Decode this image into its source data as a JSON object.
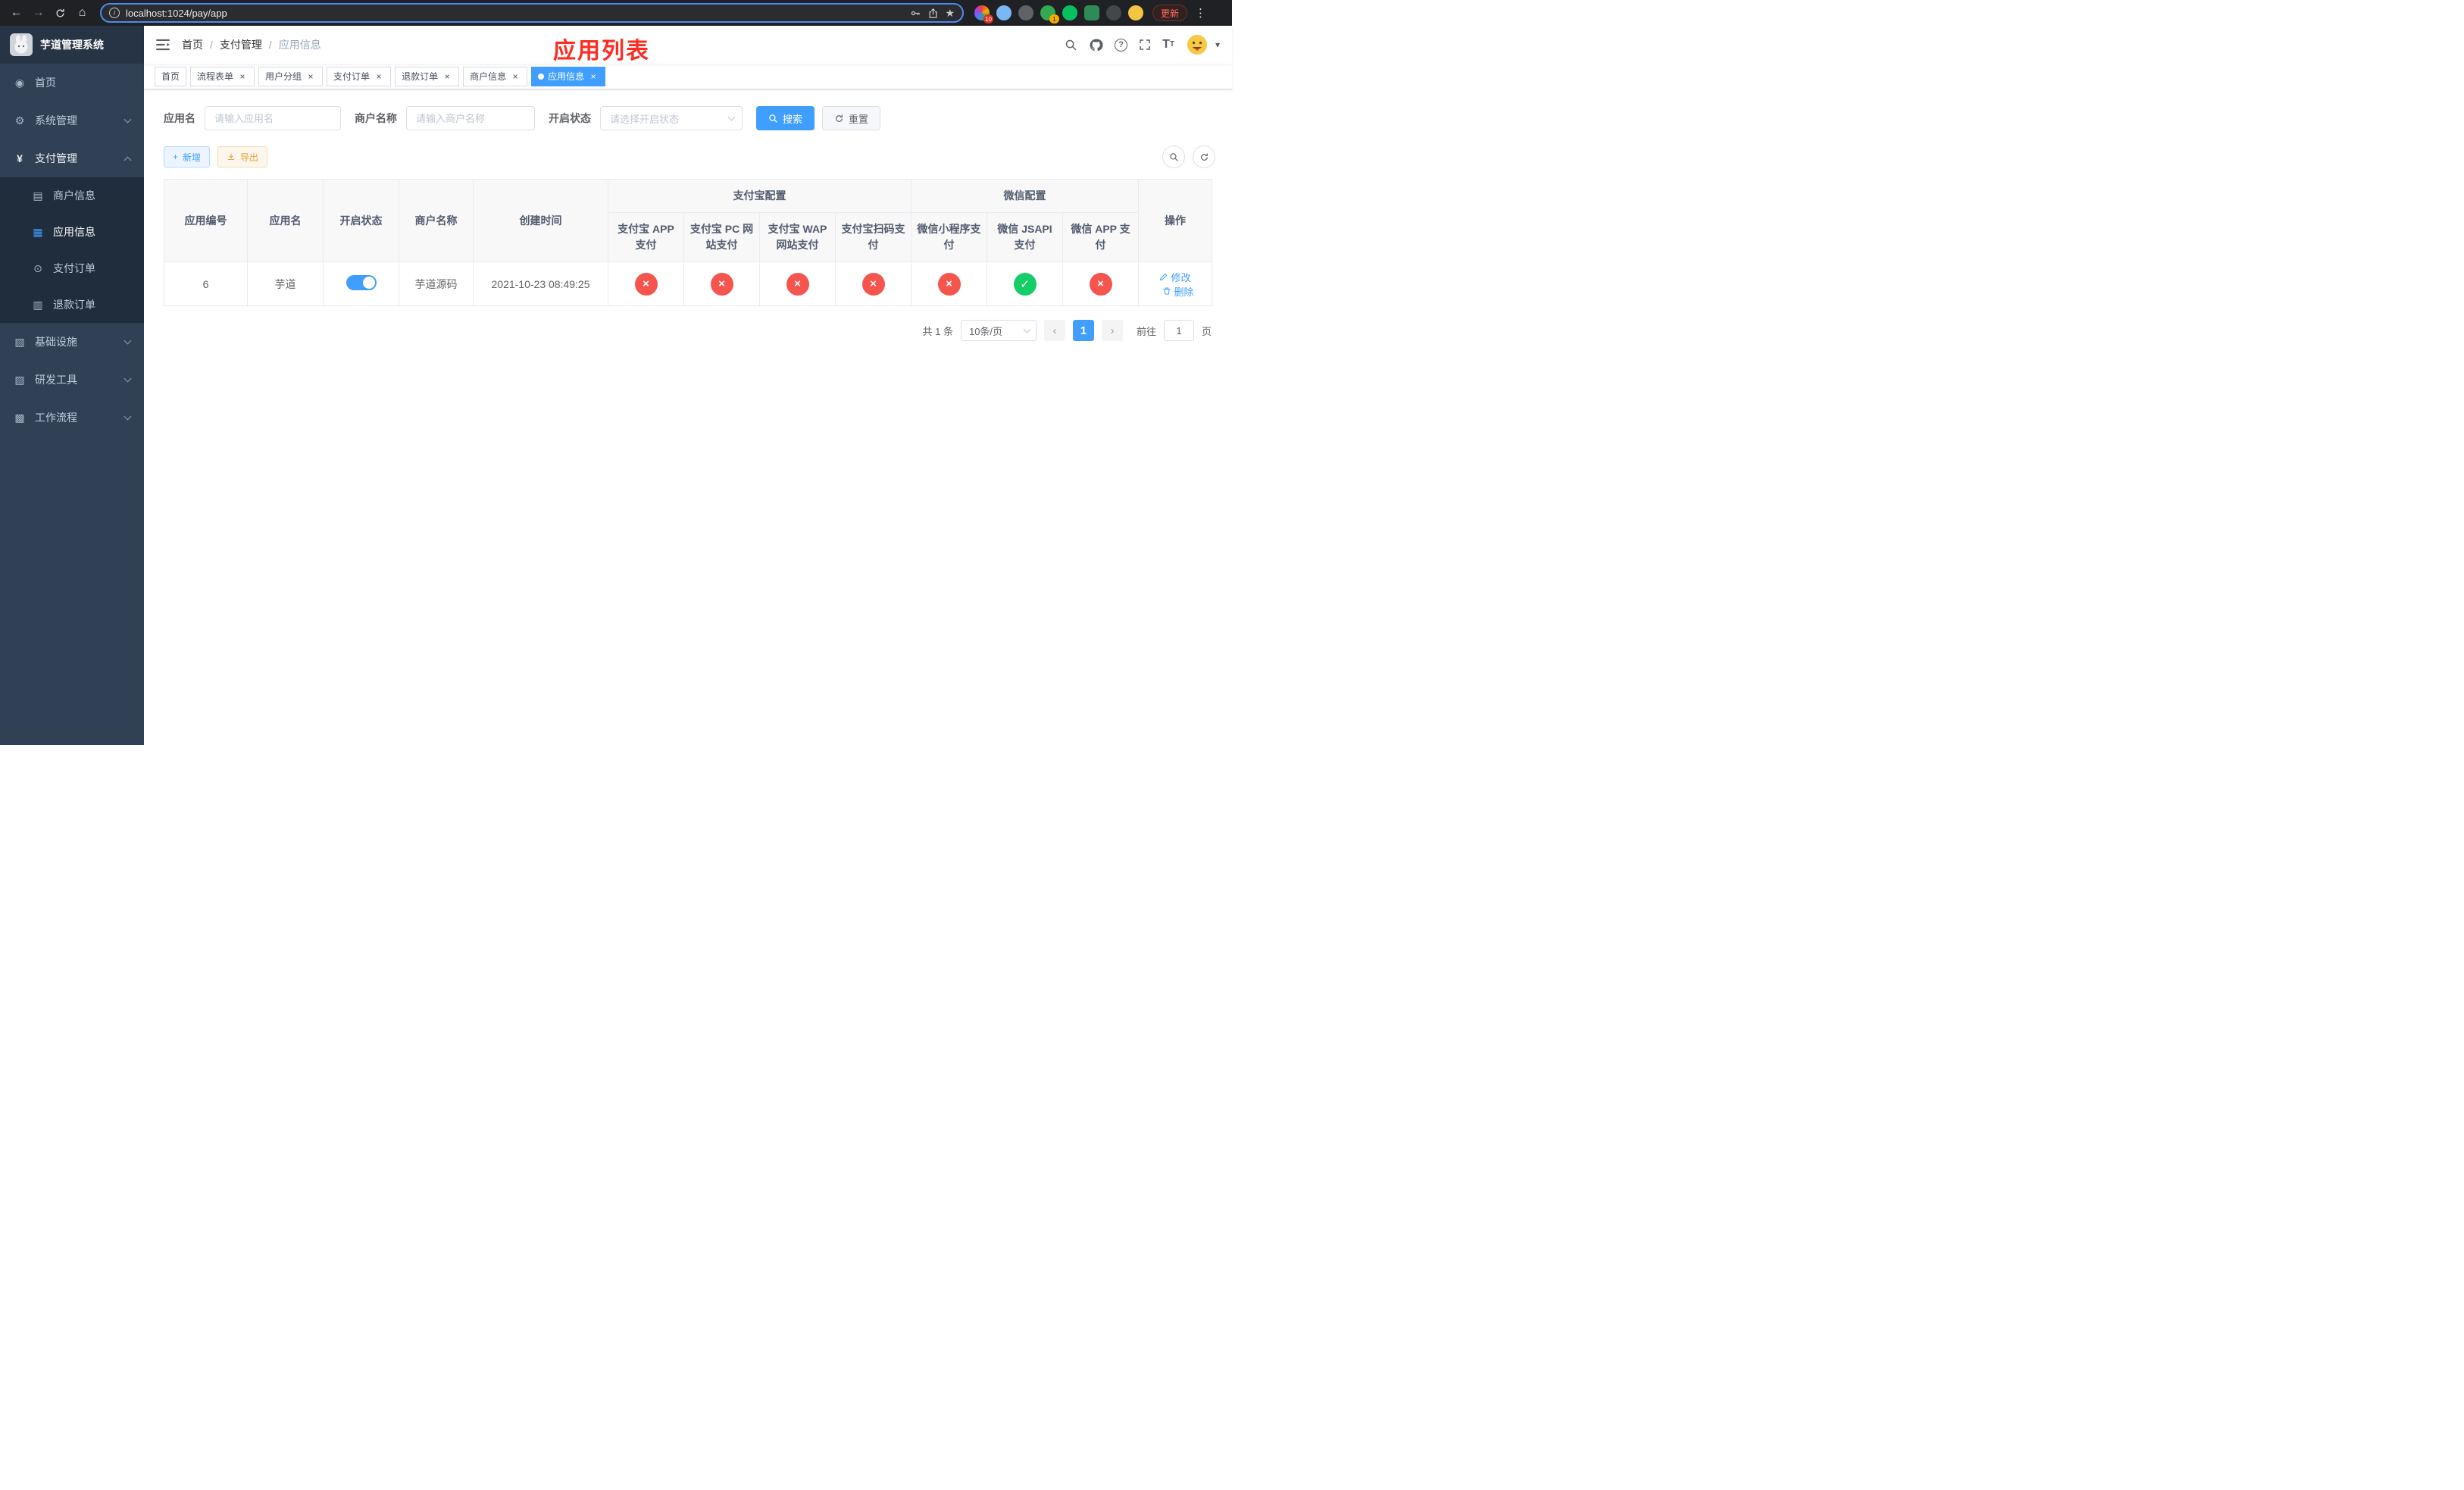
{
  "browser": {
    "url": "localhost:1024/pay/app",
    "update_label": "更新",
    "pin_badge": "10",
    "avatar_badge": "1"
  },
  "icons": {
    "back": "←",
    "forward": "→",
    "home": "⌂",
    "star": "★",
    "dots": "⋮",
    "caret_down": "▾",
    "close": "×",
    "check": "✓",
    "plus": "+",
    "question": "?",
    "font_large": "T",
    "font_small": "T",
    "prev": "‹",
    "next": "›",
    "menu_home": "◉",
    "menu_system": "⚙",
    "menu_pay": "¥",
    "menu_merchant": "▤",
    "menu_app": "▦",
    "menu_order": "⊙",
    "menu_refund": "▥",
    "menu_infra": "▧",
    "menu_devtool": "▨",
    "menu_workflow": "▩"
  },
  "sidebar": {
    "title": "芋道管理系统",
    "items": {
      "home": "首页",
      "system": "系统管理",
      "pay": "支付管理",
      "infra": "基础设施",
      "devtool": "研发工具",
      "workflow": "工作流程"
    },
    "submenu": {
      "merchant": "商户信息",
      "app": "应用信息",
      "order": "支付订单",
      "refund": "退款订单"
    }
  },
  "navbar": {
    "breadcrumb": [
      "首页",
      "支付管理",
      "应用信息"
    ],
    "separator": "/",
    "overlay_title": "应用列表"
  },
  "tabs": [
    {
      "label": "首页"
    },
    {
      "label": "流程表单"
    },
    {
      "label": "用户分组"
    },
    {
      "label": "支付订单"
    },
    {
      "label": "退款订单"
    },
    {
      "label": "商户信息"
    },
    {
      "label": "应用信息"
    }
  ],
  "filters": {
    "app_name_label": "应用名",
    "app_name_placeholder": "请输入应用名",
    "merchant_label": "商户名称",
    "merchant_placeholder": "请输入商户名称",
    "status_label": "开启状态",
    "status_placeholder": "请选择开启状态",
    "search_label": "搜索",
    "reset_label": "重置"
  },
  "toolbar": {
    "add_label": "新增",
    "export_label": "导出"
  },
  "table": {
    "groups": {
      "alipay": "支付宝配置",
      "wechat": "微信配置"
    },
    "columns": {
      "id": "应用编号",
      "name": "应用名",
      "status": "开启状态",
      "merchant": "商户名称",
      "created": "创建时间",
      "alipay_app": "支付宝 APP 支付",
      "alipay_pc": "支付宝 PC 网站支付",
      "alipay_wap": "支付宝 WAP 网站支付",
      "alipay_qr": "支付宝扫码支付",
      "wx_mini": "微信小程序支付",
      "wx_jsapi": "微信 JSAPI 支付",
      "wx_app": "微信 APP 支付",
      "actions": "操作"
    },
    "row": {
      "id": "6",
      "name": "芋道",
      "merchant": "芋道源码",
      "created": "2021-10-23 08:49:25",
      "edit_label": "修改",
      "delete_label": "删除"
    }
  },
  "pagination": {
    "total": "共 1 条",
    "page_size": "10条/页",
    "page": "1",
    "goto_label": "前往",
    "goto_value": "1",
    "unit_label": "页"
  },
  "colors": {
    "primary": "#409eff",
    "danger": "#f5554d",
    "success": "#13ce66",
    "overlay_red": "#fd2b20"
  }
}
